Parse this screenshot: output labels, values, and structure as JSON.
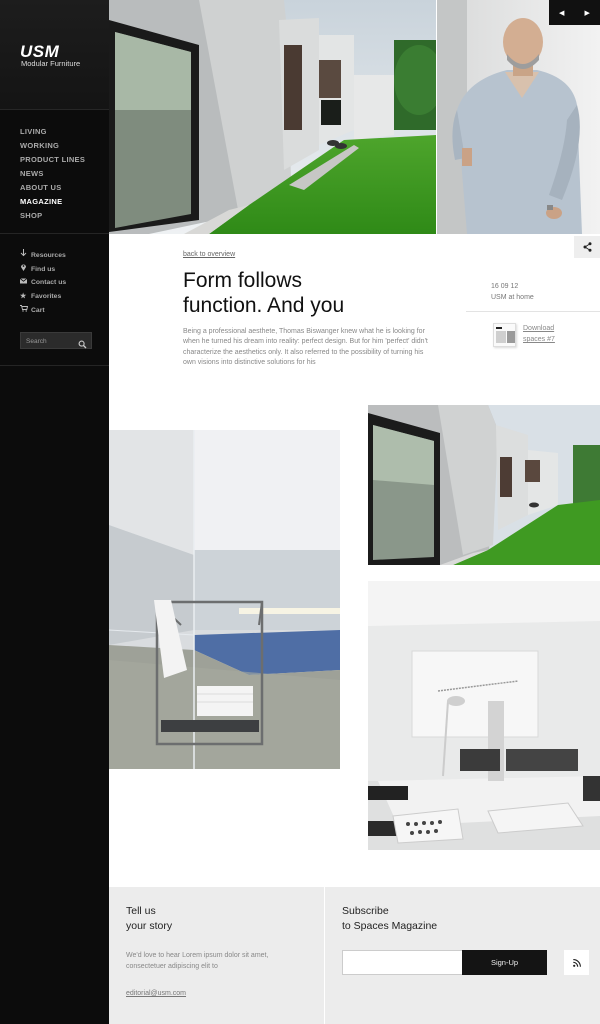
{
  "brand": {
    "name": "USM",
    "tagline": "Modular Furniture"
  },
  "nav": {
    "items": [
      {
        "label": "LIVING"
      },
      {
        "label": "WORKING"
      },
      {
        "label": "PRODUCT LINES"
      },
      {
        "label": "NEWS"
      },
      {
        "label": "ABOUT US"
      },
      {
        "label": "MAGAZINE"
      },
      {
        "label": "SHOP"
      }
    ],
    "active": "MAGAZINE"
  },
  "tools": [
    {
      "label": "Resources",
      "icon": "download-arrow-icon"
    },
    {
      "label": "Find us",
      "icon": "map-pin-icon"
    },
    {
      "label": "Contact us",
      "icon": "envelope-icon"
    },
    {
      "label": "Favorites",
      "icon": "star-icon"
    },
    {
      "label": "Cart",
      "icon": "cart-icon"
    }
  ],
  "search": {
    "placeholder": "Search"
  },
  "slider": {
    "prev_icon": "triangle-left-icon",
    "next_icon": "triangle-right-icon"
  },
  "article": {
    "back_label": "back to overview",
    "title_line1": "Form follows",
    "title_line2": "function. And you",
    "body": "Being a professional aesthete, Thomas Biswanger knew what he is looking for when he turned his dream into reality: perfect design. But for him 'perfect' didn't characterize the aesthetics only. It also referred to the possibility of turning his own visions into distinctive solutions for his",
    "date": "16 09 12",
    "category": "USM at home",
    "download_line1": "Download",
    "download_line2": "spaces #7"
  },
  "footer": {
    "story_title_line1": "Tell us",
    "story_title_line2": "your story",
    "story_text": "We'd love to hear Lorem ipsum dolor sit amet, consectetuer adipiscing elit to",
    "story_email": "editorial@usm.com",
    "subscribe_title_line1": "Subscribe",
    "subscribe_title_line2": "to Spaces Magazine",
    "signup_label": "Sign-Up",
    "rss_icon": "rss-icon"
  },
  "colors": {
    "sidebar_bg": "#0c0c0c",
    "accent_dark": "#141414",
    "footer_bg": "#ececec",
    "grass": "#3f9a22"
  }
}
